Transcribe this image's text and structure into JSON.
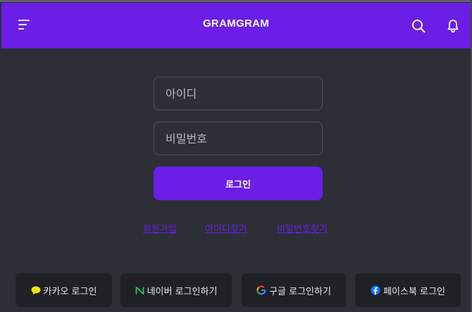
{
  "header": {
    "brand": "GRAMGRAM",
    "icons": {
      "menu": "hamburger-icon",
      "search": "search-icon",
      "notifications": "bell-icon"
    },
    "color": "#6a1ee6"
  },
  "login_form": {
    "id_placeholder": "아이디",
    "password_placeholder": "비밀번호",
    "submit_label": "로그인"
  },
  "links": {
    "join": "회원가입",
    "find_id": "아이디찾기",
    "find_password": "비밀번호찾기"
  },
  "social_logins": {
    "kakao": {
      "label": "카카오 로그인",
      "icon": "speech-bubble-icon",
      "color": "#f7e600"
    },
    "naver": {
      "label": "네이버 로그인하기",
      "icon": "naver-n-icon",
      "color": "#19ce60"
    },
    "google": {
      "label": "구글 로그인하기",
      "icon": "google-g-icon",
      "color": "#ea4335"
    },
    "facebook": {
      "label": "페이스북 로그인",
      "icon": "facebook-icon",
      "color": "#1877f2"
    }
  },
  "colors": {
    "background": "#2c2f36",
    "accent": "#6a1ee6",
    "button_dark": "#1f2126"
  }
}
